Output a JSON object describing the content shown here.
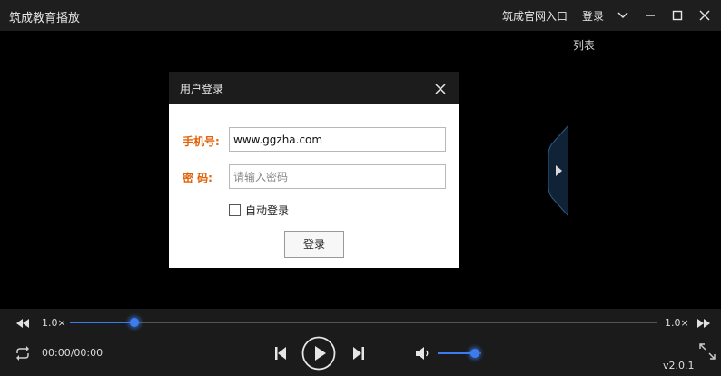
{
  "titlebar": {
    "title": "筑成教育播放",
    "website_link": "筑成官网入口",
    "login_link": "登录",
    "icons": [
      "chevron-down-icon",
      "minimize-icon",
      "maximize-icon",
      "close-icon"
    ]
  },
  "playlist": {
    "title": "列表",
    "collapse_icon": "play-triangle-icon"
  },
  "login_dialog": {
    "title": "用户登录",
    "phone_label": "手机号:",
    "phone_value": "www.ggzha.com",
    "password_label": "密 码:",
    "password_placeholder": "请输入密码",
    "remember_label": "自动登录",
    "remember_checked": false,
    "submit_label": "登录",
    "label_color": "#e0630a"
  },
  "controls": {
    "speed_left": "1.0×",
    "speed_right": "1.0×",
    "time": "00:00/00:00",
    "version": "v2.0.1",
    "progress_fraction": 0.11,
    "volume_fraction": 0.85,
    "accent_color": "#3b7df0"
  }
}
